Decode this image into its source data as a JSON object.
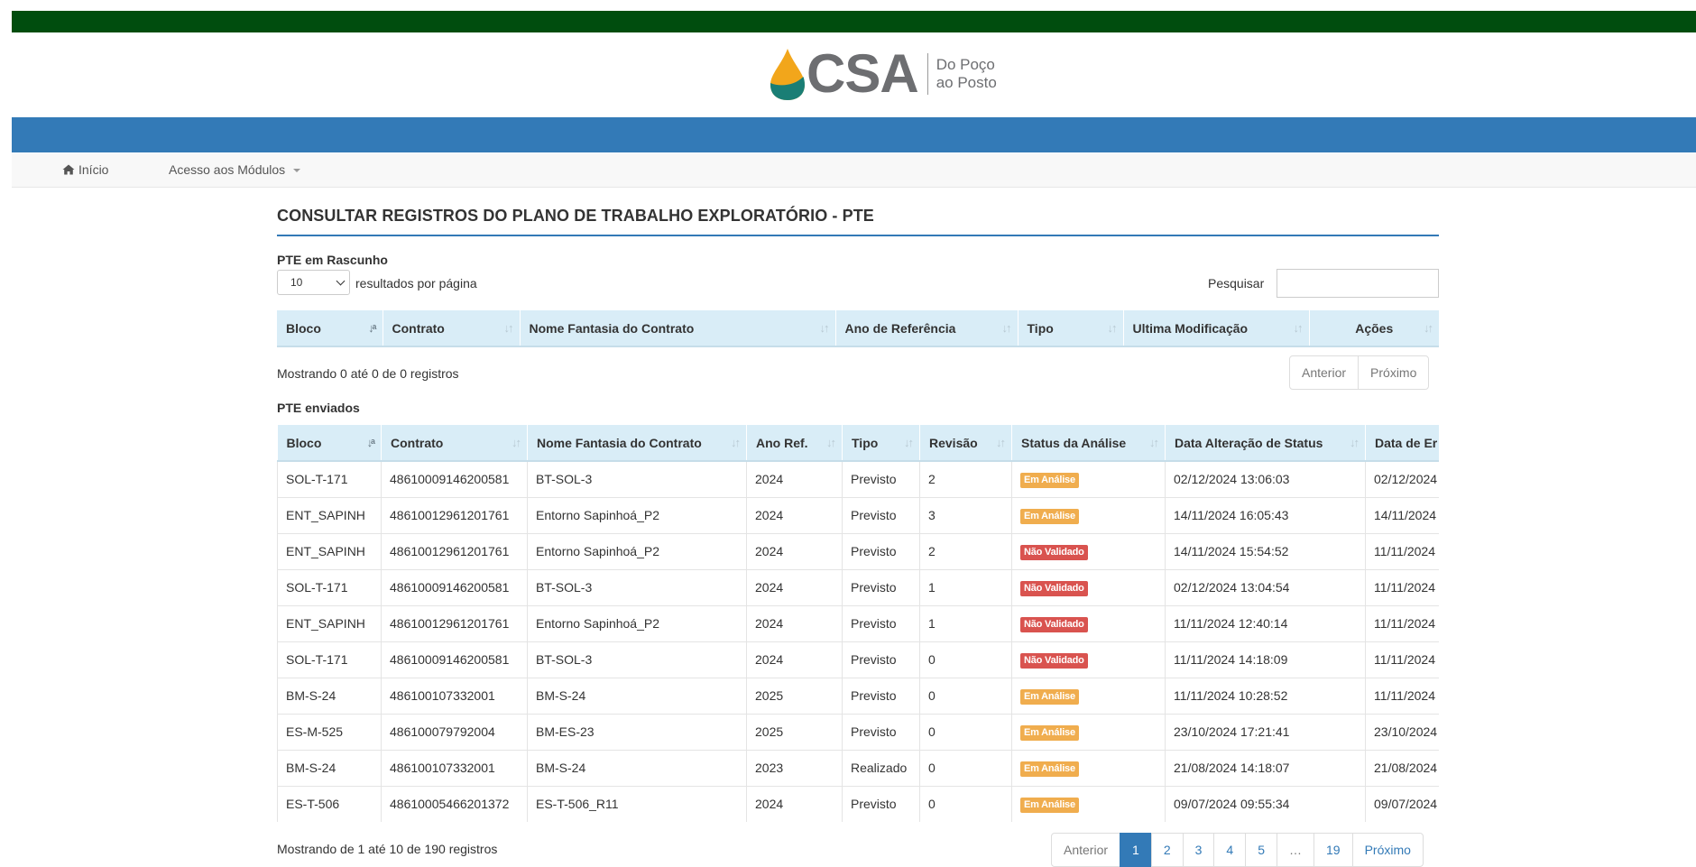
{
  "brand": {
    "name": "CSA",
    "tagline_line1": "Do Poço",
    "tagline_line2": "ao Posto",
    "drop_color_top": "#f2a61b",
    "drop_color_bottom": "#1a7e75"
  },
  "colors": {
    "top_bar": "#004d0e",
    "blue_bar": "#337ab7",
    "badge_em_analise": "#f0ad4e",
    "badge_nao_validado": "#d9534f"
  },
  "nav": {
    "home_label": "Início",
    "home_icon": "home-icon",
    "modules_label": "Acesso aos Módulos"
  },
  "page": {
    "title": "CONSULTAR REGISTROS DO PLANO DE TRABALHO EXPLORATÓRIO - PTE"
  },
  "draft": {
    "section_title": "PTE em Rascunho",
    "page_length_value": "10",
    "page_length_suffix": "resultados por página",
    "search_label": "Pesquisar",
    "columns": [
      "Bloco",
      "Contrato",
      "Nome Fantasia do Contrato",
      "Ano de Referência",
      "Tipo",
      "Ultima Modificação",
      "Ações"
    ],
    "info": "Mostrando 0 até 0 de 0 registros",
    "prev_label": "Anterior",
    "next_label": "Próximo"
  },
  "sent": {
    "section_title": "PTE enviados",
    "columns": [
      "Bloco",
      "Contrato",
      "Nome Fantasia do Contrato",
      "Ano Ref.",
      "Tipo",
      "Revisão",
      "Status da Análise",
      "Data Alteração de Status",
      "Data de Er"
    ],
    "rows": [
      {
        "bloco": "SOL-T-171",
        "contrato": "48610009146200581",
        "nome": "BT-SOL-3",
        "ano": "2024",
        "tipo": "Previsto",
        "revisao": "2",
        "status": "Em Análise",
        "status_kind": "warning",
        "data_status": "02/12/2024 13:06:03",
        "data_envio": "02/12/2024"
      },
      {
        "bloco": "ENT_SAPINH",
        "contrato": "48610012961201761",
        "nome": "Entorno Sapinhoá_P2",
        "ano": "2024",
        "tipo": "Previsto",
        "revisao": "3",
        "status": "Em Análise",
        "status_kind": "warning",
        "data_status": "14/11/2024 16:05:43",
        "data_envio": "14/11/2024"
      },
      {
        "bloco": "ENT_SAPINH",
        "contrato": "48610012961201761",
        "nome": "Entorno Sapinhoá_P2",
        "ano": "2024",
        "tipo": "Previsto",
        "revisao": "2",
        "status": "Não Validado",
        "status_kind": "danger",
        "data_status": "14/11/2024 15:54:52",
        "data_envio": "11/11/2024"
      },
      {
        "bloco": "SOL-T-171",
        "contrato": "48610009146200581",
        "nome": "BT-SOL-3",
        "ano": "2024",
        "tipo": "Previsto",
        "revisao": "1",
        "status": "Não Validado",
        "status_kind": "danger",
        "data_status": "02/12/2024 13:04:54",
        "data_envio": "11/11/2024"
      },
      {
        "bloco": "ENT_SAPINH",
        "contrato": "48610012961201761",
        "nome": "Entorno Sapinhoá_P2",
        "ano": "2024",
        "tipo": "Previsto",
        "revisao": "1",
        "status": "Não Validado",
        "status_kind": "danger",
        "data_status": "11/11/2024 12:40:14",
        "data_envio": "11/11/2024"
      },
      {
        "bloco": "SOL-T-171",
        "contrato": "48610009146200581",
        "nome": "BT-SOL-3",
        "ano": "2024",
        "tipo": "Previsto",
        "revisao": "0",
        "status": "Não Validado",
        "status_kind": "danger",
        "data_status": "11/11/2024 14:18:09",
        "data_envio": "11/11/2024"
      },
      {
        "bloco": "BM-S-24",
        "contrato": "486100107332001",
        "nome": "BM-S-24",
        "ano": "2025",
        "tipo": "Previsto",
        "revisao": "0",
        "status": "Em Análise",
        "status_kind": "warning",
        "data_status": "11/11/2024 10:28:52",
        "data_envio": "11/11/2024"
      },
      {
        "bloco": "ES-M-525",
        "contrato": "486100079792004",
        "nome": "BM-ES-23",
        "ano": "2025",
        "tipo": "Previsto",
        "revisao": "0",
        "status": "Em Análise",
        "status_kind": "warning",
        "data_status": "23/10/2024 17:21:41",
        "data_envio": "23/10/2024"
      },
      {
        "bloco": "BM-S-24",
        "contrato": "486100107332001",
        "nome": "BM-S-24",
        "ano": "2023",
        "tipo": "Realizado",
        "revisao": "0",
        "status": "Em Análise",
        "status_kind": "warning",
        "data_status": "21/08/2024 14:18:07",
        "data_envio": "21/08/2024"
      },
      {
        "bloco": "ES-T-506",
        "contrato": "48610005466201372",
        "nome": "ES-T-506_R11",
        "ano": "2024",
        "tipo": "Previsto",
        "revisao": "0",
        "status": "Em Análise",
        "status_kind": "warning",
        "data_status": "09/07/2024 09:55:34",
        "data_envio": "09/07/2024"
      }
    ],
    "info": "Mostrando de 1 até 10 de 190 registros",
    "pagination": {
      "prev_label": "Anterior",
      "pages": [
        "1",
        "2",
        "3",
        "4",
        "5",
        "…",
        "19"
      ],
      "current": "1",
      "next_label": "Próximo"
    }
  }
}
